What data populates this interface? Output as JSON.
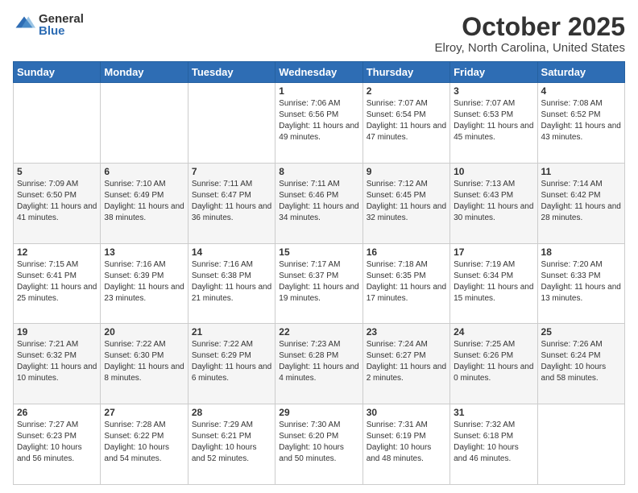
{
  "header": {
    "logo_general": "General",
    "logo_blue": "Blue",
    "title": "October 2025",
    "subtitle": "Elroy, North Carolina, United States"
  },
  "weekdays": [
    "Sunday",
    "Monday",
    "Tuesday",
    "Wednesday",
    "Thursday",
    "Friday",
    "Saturday"
  ],
  "weeks": [
    [
      {
        "day": "",
        "sunrise": "",
        "sunset": "",
        "daylight": ""
      },
      {
        "day": "",
        "sunrise": "",
        "sunset": "",
        "daylight": ""
      },
      {
        "day": "",
        "sunrise": "",
        "sunset": "",
        "daylight": ""
      },
      {
        "day": "1",
        "sunrise": "7:06 AM",
        "sunset": "6:56 PM",
        "daylight": "11 hours and 49 minutes."
      },
      {
        "day": "2",
        "sunrise": "7:07 AM",
        "sunset": "6:54 PM",
        "daylight": "11 hours and 47 minutes."
      },
      {
        "day": "3",
        "sunrise": "7:07 AM",
        "sunset": "6:53 PM",
        "daylight": "11 hours and 45 minutes."
      },
      {
        "day": "4",
        "sunrise": "7:08 AM",
        "sunset": "6:52 PM",
        "daylight": "11 hours and 43 minutes."
      }
    ],
    [
      {
        "day": "5",
        "sunrise": "7:09 AM",
        "sunset": "6:50 PM",
        "daylight": "11 hours and 41 minutes."
      },
      {
        "day": "6",
        "sunrise": "7:10 AM",
        "sunset": "6:49 PM",
        "daylight": "11 hours and 38 minutes."
      },
      {
        "day": "7",
        "sunrise": "7:11 AM",
        "sunset": "6:47 PM",
        "daylight": "11 hours and 36 minutes."
      },
      {
        "day": "8",
        "sunrise": "7:11 AM",
        "sunset": "6:46 PM",
        "daylight": "11 hours and 34 minutes."
      },
      {
        "day": "9",
        "sunrise": "7:12 AM",
        "sunset": "6:45 PM",
        "daylight": "11 hours and 32 minutes."
      },
      {
        "day": "10",
        "sunrise": "7:13 AM",
        "sunset": "6:43 PM",
        "daylight": "11 hours and 30 minutes."
      },
      {
        "day": "11",
        "sunrise": "7:14 AM",
        "sunset": "6:42 PM",
        "daylight": "11 hours and 28 minutes."
      }
    ],
    [
      {
        "day": "12",
        "sunrise": "7:15 AM",
        "sunset": "6:41 PM",
        "daylight": "11 hours and 25 minutes."
      },
      {
        "day": "13",
        "sunrise": "7:16 AM",
        "sunset": "6:39 PM",
        "daylight": "11 hours and 23 minutes."
      },
      {
        "day": "14",
        "sunrise": "7:16 AM",
        "sunset": "6:38 PM",
        "daylight": "11 hours and 21 minutes."
      },
      {
        "day": "15",
        "sunrise": "7:17 AM",
        "sunset": "6:37 PM",
        "daylight": "11 hours and 19 minutes."
      },
      {
        "day": "16",
        "sunrise": "7:18 AM",
        "sunset": "6:35 PM",
        "daylight": "11 hours and 17 minutes."
      },
      {
        "day": "17",
        "sunrise": "7:19 AM",
        "sunset": "6:34 PM",
        "daylight": "11 hours and 15 minutes."
      },
      {
        "day": "18",
        "sunrise": "7:20 AM",
        "sunset": "6:33 PM",
        "daylight": "11 hours and 13 minutes."
      }
    ],
    [
      {
        "day": "19",
        "sunrise": "7:21 AM",
        "sunset": "6:32 PM",
        "daylight": "11 hours and 10 minutes."
      },
      {
        "day": "20",
        "sunrise": "7:22 AM",
        "sunset": "6:30 PM",
        "daylight": "11 hours and 8 minutes."
      },
      {
        "day": "21",
        "sunrise": "7:22 AM",
        "sunset": "6:29 PM",
        "daylight": "11 hours and 6 minutes."
      },
      {
        "day": "22",
        "sunrise": "7:23 AM",
        "sunset": "6:28 PM",
        "daylight": "11 hours and 4 minutes."
      },
      {
        "day": "23",
        "sunrise": "7:24 AM",
        "sunset": "6:27 PM",
        "daylight": "11 hours and 2 minutes."
      },
      {
        "day": "24",
        "sunrise": "7:25 AM",
        "sunset": "6:26 PM",
        "daylight": "11 hours and 0 minutes."
      },
      {
        "day": "25",
        "sunrise": "7:26 AM",
        "sunset": "6:24 PM",
        "daylight": "10 hours and 58 minutes."
      }
    ],
    [
      {
        "day": "26",
        "sunrise": "7:27 AM",
        "sunset": "6:23 PM",
        "daylight": "10 hours and 56 minutes."
      },
      {
        "day": "27",
        "sunrise": "7:28 AM",
        "sunset": "6:22 PM",
        "daylight": "10 hours and 54 minutes."
      },
      {
        "day": "28",
        "sunrise": "7:29 AM",
        "sunset": "6:21 PM",
        "daylight": "10 hours and 52 minutes."
      },
      {
        "day": "29",
        "sunrise": "7:30 AM",
        "sunset": "6:20 PM",
        "daylight": "10 hours and 50 minutes."
      },
      {
        "day": "30",
        "sunrise": "7:31 AM",
        "sunset": "6:19 PM",
        "daylight": "10 hours and 48 minutes."
      },
      {
        "day": "31",
        "sunrise": "7:32 AM",
        "sunset": "6:18 PM",
        "daylight": "10 hours and 46 minutes."
      },
      {
        "day": "",
        "sunrise": "",
        "sunset": "",
        "daylight": ""
      }
    ]
  ]
}
